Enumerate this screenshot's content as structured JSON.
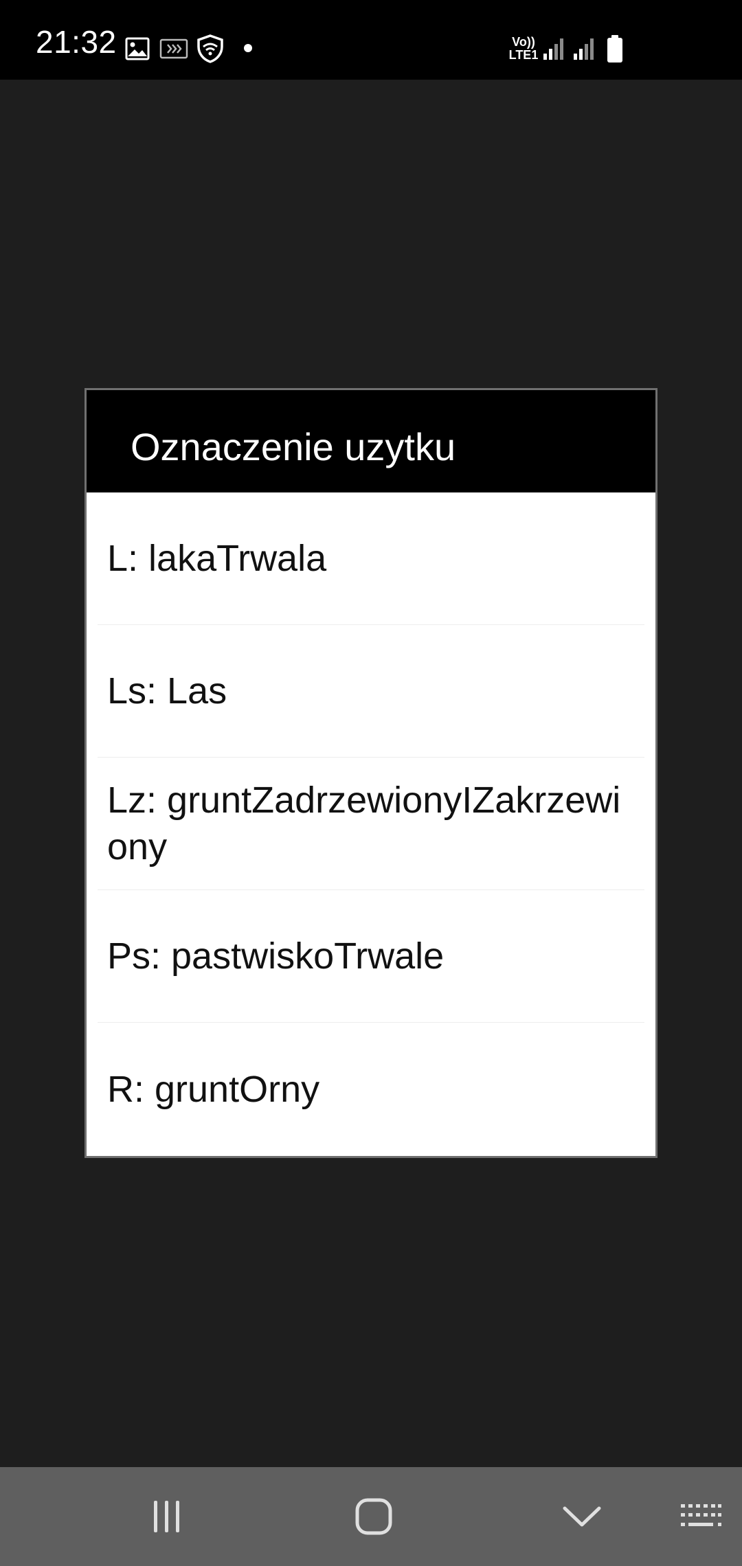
{
  "status_bar": {
    "time": "21:32",
    "network_label_top": "Vo))",
    "network_label_bottom": "LTE1",
    "icons": [
      "gallery-icon",
      "cast-icon",
      "vpn-shield-icon",
      "dot-icon",
      "signal-icon",
      "signal-icon",
      "battery-icon"
    ]
  },
  "dialog": {
    "title": "Oznaczenie uzytku",
    "options": [
      {
        "label": "L: lakaTrwala"
      },
      {
        "label": "Ls: Las"
      },
      {
        "label": "Lz: gruntZadrzewionyIZakrzewiony"
      },
      {
        "label": "Ps: pastwiskoTrwale"
      },
      {
        "label": "R: gruntOrny"
      }
    ]
  },
  "nav_bar": {
    "buttons": [
      "recents-icon",
      "home-icon",
      "back-icon",
      "keyboard-icon"
    ]
  },
  "colors": {
    "background": "#1e1e1e",
    "status_bar": "#000000",
    "dialog_header": "#000000",
    "dialog_body": "#ffffff",
    "nav_bar": "#5f5f5f"
  }
}
